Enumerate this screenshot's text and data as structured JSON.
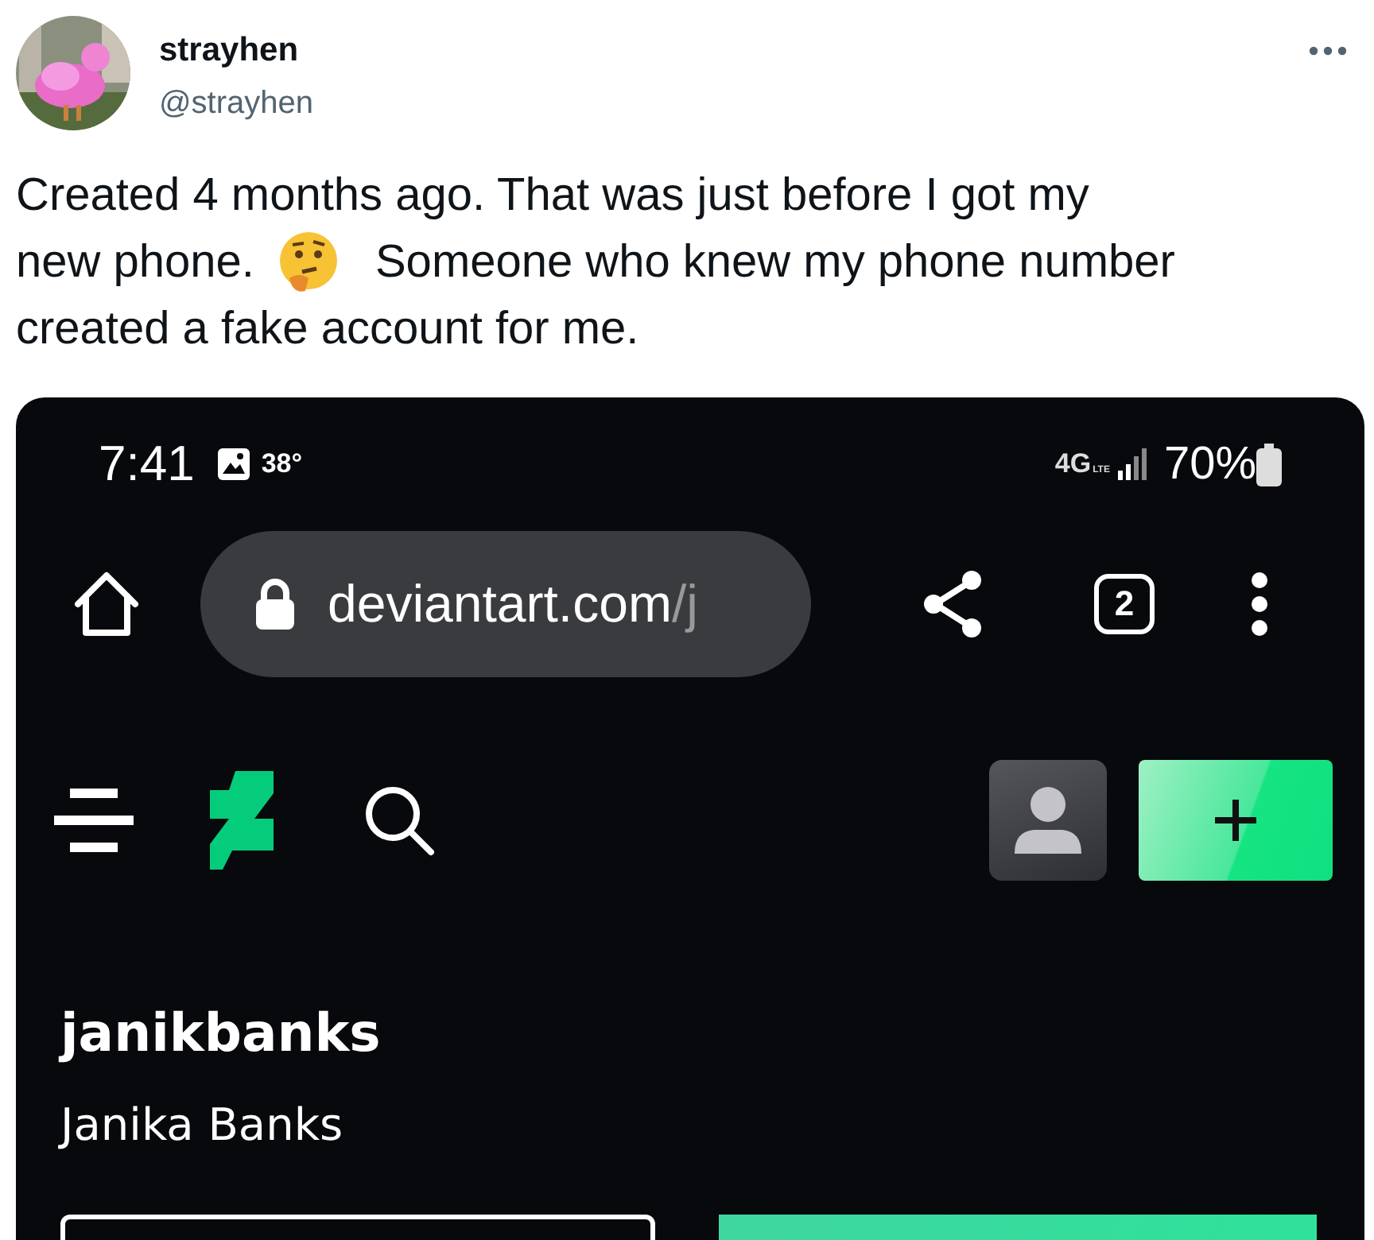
{
  "tweet": {
    "display_name": "strayhen",
    "handle": "@strayhen",
    "lines": [
      "Created 4 months ago. That was just before I got my",
      "new phone.",
      "Someone who knew my phone number",
      "created a fake account for me."
    ]
  },
  "phone": {
    "status_bar": {
      "time": "7:41",
      "temperature": "38°",
      "network": "4G",
      "network_sub": "LTE",
      "battery": "70%"
    },
    "browser": {
      "url_host": "deviantart.com",
      "url_path": "/j",
      "tab_count": "2"
    },
    "profile": {
      "username": "janikbanks",
      "full_name": "Janika Banks"
    }
  }
}
